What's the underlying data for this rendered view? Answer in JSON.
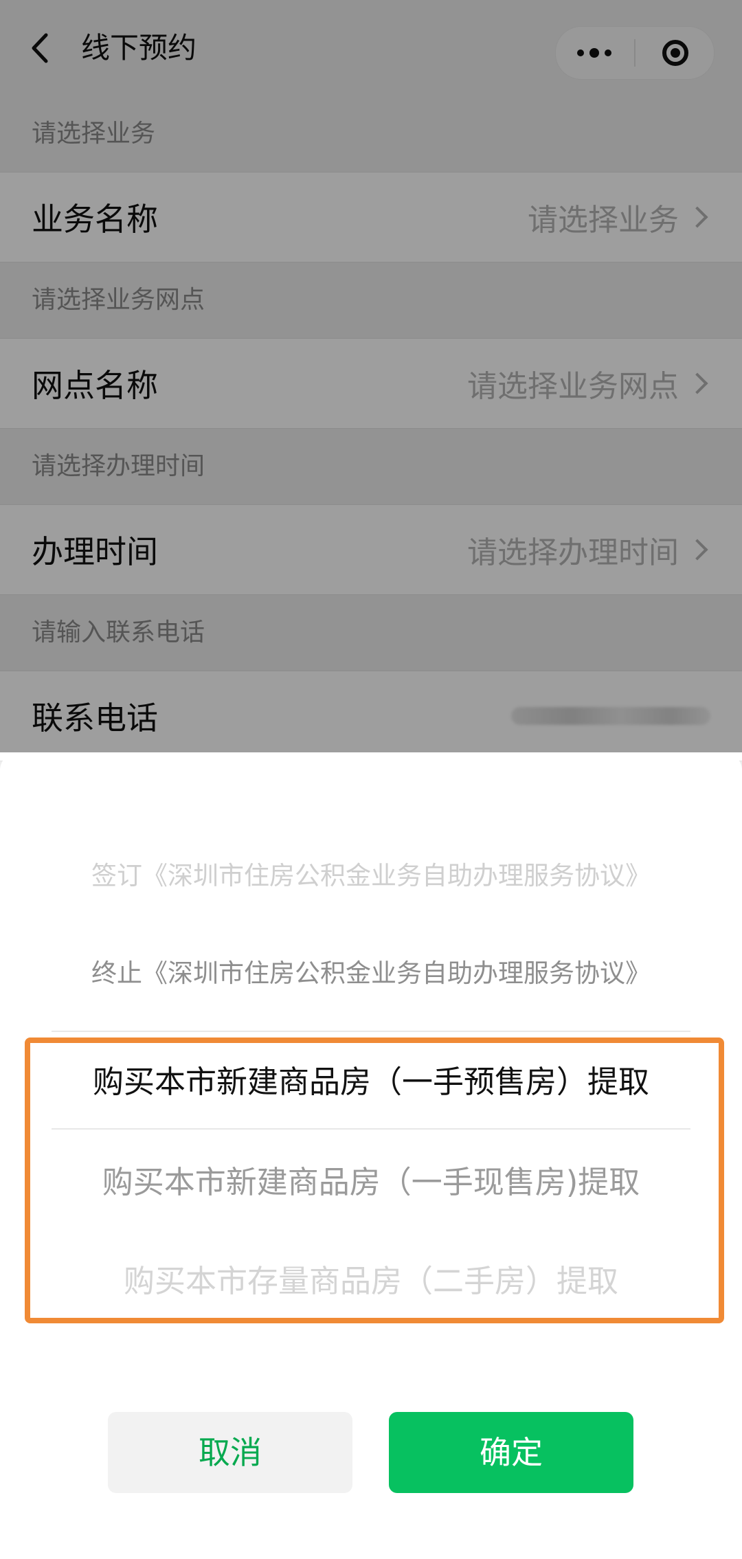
{
  "navbar": {
    "title": "线下预约"
  },
  "form": {
    "sections": [
      {
        "hint": "请选择业务",
        "label": "业务名称",
        "value": "请选择业务"
      },
      {
        "hint": "请选择业务网点",
        "label": "网点名称",
        "value": "请选择业务网点"
      },
      {
        "hint": "请选择办理时间",
        "label": "办理时间",
        "value": "请选择办理时间"
      },
      {
        "hint": "请输入联系电话",
        "label": "联系电话"
      }
    ]
  },
  "picker": {
    "items": [
      "签订《深圳市住房公积金业务自助办理服务协议》",
      "终止《深圳市住房公积金业务自助办理服务协议》",
      "购买本市新建商品房（一手预售房）提取",
      "购买本市新建商品房（一手现售房)提取",
      "购买本市存量商品房（二手房）提取"
    ],
    "selected_index": 2,
    "cancel_label": "取消",
    "confirm_label": "确定"
  },
  "colors": {
    "confirm_green": "#07c160",
    "cancel_text_green": "#07a94f",
    "highlight_orange": "#f08a35",
    "placeholder_gray": "#b3b3b3"
  },
  "icons": {
    "back": "chevron-left-icon",
    "more": "more-dots-icon",
    "close": "target-circle-icon",
    "row_arrow": "chevron-right-icon"
  }
}
